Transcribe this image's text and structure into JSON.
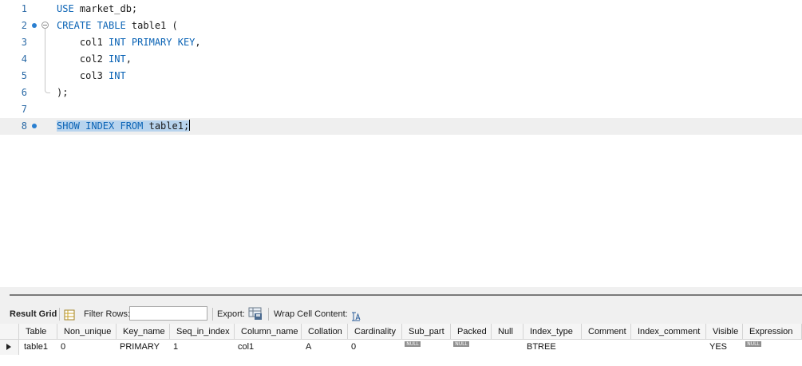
{
  "editor": {
    "line_numbers": [
      "1",
      "2",
      "3",
      "4",
      "5",
      "6",
      "7",
      "8"
    ],
    "code": {
      "l1_kw": "USE",
      "l1_rest": " market_db;",
      "l2_kw": "CREATE TABLE",
      "l2_rest": " table1 (",
      "l3_a": "    col1 ",
      "l3_kw": "INT PRIMARY KEY",
      "l3_b": ",",
      "l4_a": "    col2 ",
      "l4_kw": "INT",
      "l4_b": ",",
      "l5_a": "    col3 ",
      "l5_kw": "INT",
      "l6": ");",
      "l8_kw1": "SHOW INDEX FROM",
      "l8_rest": " table1;"
    }
  },
  "toolbar": {
    "result_grid": "Result Grid",
    "filter_rows": "Filter Rows:",
    "filter_value": "",
    "export": "Export:",
    "wrap_cell": "Wrap Cell Content:"
  },
  "grid": {
    "columns": [
      "Table",
      "Non_unique",
      "Key_name",
      "Seq_in_index",
      "Column_name",
      "Collation",
      "Cardinality",
      "Sub_part",
      "Packed",
      "Null",
      "Index_type",
      "Comment",
      "Index_comment",
      "Visible",
      "Expression"
    ],
    "row": {
      "Table": "table1",
      "Non_unique": "0",
      "Key_name": "PRIMARY",
      "Seq_in_index": "1",
      "Column_name": "col1",
      "Collation": "A",
      "Cardinality": "0",
      "Sub_part": "NULL",
      "Packed": "NULL",
      "Null": "",
      "Index_type": "BTREE",
      "Comment": "",
      "Index_comment": "",
      "Visible": "YES",
      "Expression": "NULL"
    }
  },
  "colors": {
    "keyword": "#0a63b5",
    "selection": "#b8d4ee",
    "line_number": "#2b6aa6"
  }
}
